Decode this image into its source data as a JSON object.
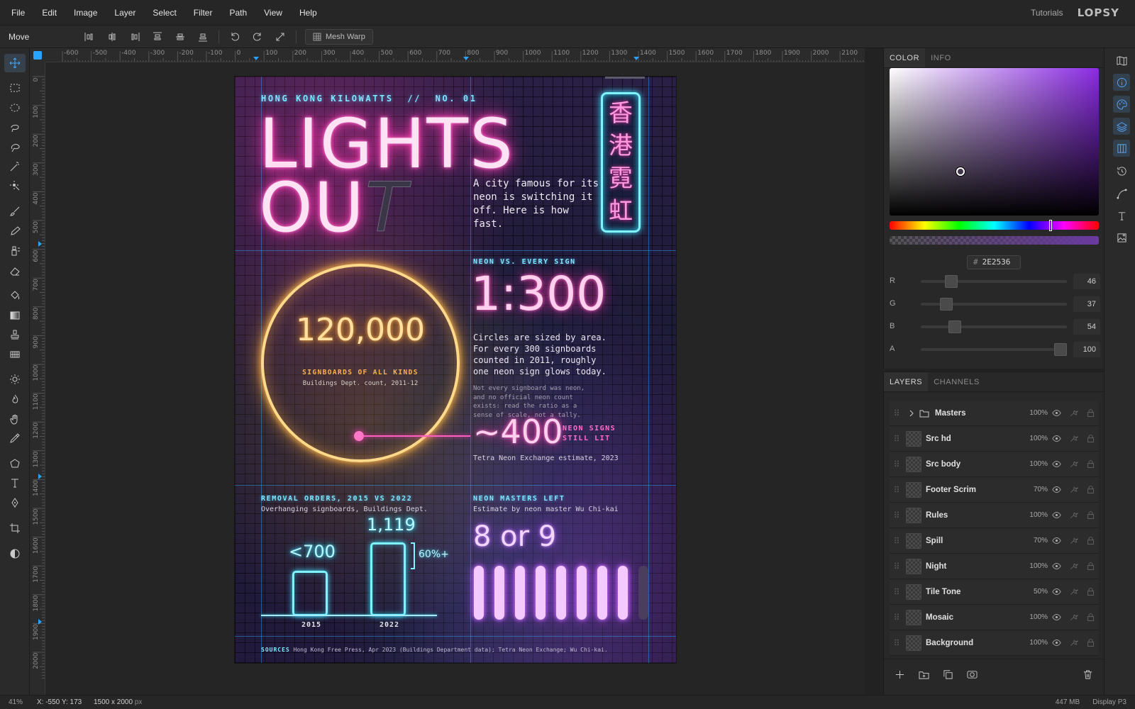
{
  "menu": [
    "File",
    "Edit",
    "Image",
    "Layer",
    "Select",
    "Filter",
    "Path",
    "View",
    "Help"
  ],
  "header": {
    "tutorials": "Tutorials",
    "brand": "LOPSY"
  },
  "options": {
    "tool_name": "Move",
    "mesh_warp": "Mesh Warp"
  },
  "toolbar_icons": [
    "move-icon",
    "rect-select-icon",
    "ellipse-select-icon",
    "lasso-icon",
    "magnetic-lasso-icon",
    "magic-wand-icon",
    "quick-select-icon",
    "brush-icon",
    "pencil-icon",
    "clone-icon",
    "eraser-icon",
    "bucket-icon",
    "gradient-icon",
    "stamp-icon",
    "pattern-icon",
    "dodge-icon",
    "burn-icon",
    "hand-icon",
    "eyedropper-icon",
    "shape-icon",
    "text-icon",
    "pen-icon",
    "crop-icon",
    "contrast-icon"
  ],
  "hruler_labels": [
    "-600",
    "-500",
    "-400",
    "-300",
    "-200",
    "-100",
    "0",
    "100",
    "200",
    "300",
    "400",
    "500",
    "600",
    "700",
    "800",
    "900",
    "1000",
    "1100",
    "1200",
    "1300",
    "1400",
    "1500",
    "1600",
    "1700",
    "1800",
    "1900",
    "2000",
    "2100"
  ],
  "vruler_labels": [
    "0",
    "100",
    "200",
    "300",
    "400",
    "500",
    "600",
    "700",
    "800",
    "900",
    "1000",
    "1100",
    "1200",
    "1300",
    "1400",
    "1500",
    "1600",
    "1700",
    "1800",
    "1900",
    "2000"
  ],
  "poster": {
    "kicker": "HONG KONG KILOWATTS  //  NO. 01",
    "title_line1": "LIGHTS",
    "title_line2": "OU",
    "title_t": "T",
    "intro": "A city famous for its neon is switching it off. Here is how fast.",
    "sign_chars": [
      "香",
      "港",
      "霓",
      "虹"
    ],
    "big_number": "120,000",
    "big_label": "SIGNBOARDS OF ALL KINDS",
    "big_source": "Buildings Dept. count, 2011-12",
    "ratio_label": "NEON VS. EVERY SIGN",
    "ratio": "1:300",
    "ratio_text": "Circles are sized by area. For every 300 signboards counted in 2011, roughly one neon sign glows today.",
    "ratio_note": "Not every signboard was neon, and no official neon count exists: read the ratio as a sense of scale, not a tally.",
    "approx": "~400",
    "approx_label_1": "NEON SIGNS",
    "approx_label_2": "STILL LIT",
    "approx_source": "Tetra Neon Exchange estimate, 2023",
    "removal_title": "REMOVAL ORDERS, 2015 VS 2022",
    "removal_sub": "Overhanging signboards, Buildings Dept.",
    "bar_2015_value": "<700",
    "bar_2022_value": "1,119",
    "bar_2015_label": "2015",
    "bar_2022_label": "2022",
    "pct": "60%+",
    "masters_title": "NEON MASTERS LEFT",
    "masters_sub": "Estimate by neon master Wu Chi-kai",
    "masters_value": "8 or 9",
    "sources_label": "SOURCES",
    "sources_text": "Hong Kong Free Press, Apr 2023 (Buildings Department data); Tetra Neon Exchange; Wu Chi-kai."
  },
  "color_panel": {
    "tabs": [
      "COLOR",
      "INFO"
    ],
    "hex_label": "#",
    "hex": "2E2536",
    "channels": [
      {
        "label": "R",
        "value": "46",
        "level": 0.18
      },
      {
        "label": "G",
        "value": "37",
        "level": 0.145
      },
      {
        "label": "B",
        "value": "54",
        "level": 0.21
      },
      {
        "label": "A",
        "value": "100",
        "level": 1.0
      }
    ]
  },
  "layers_panel": {
    "tabs": [
      "LAYERS",
      "CHANNELS"
    ],
    "layers": [
      {
        "name": "Masters",
        "opacity": "100%",
        "group": true
      },
      {
        "name": "Src hd",
        "opacity": "100%"
      },
      {
        "name": "Src body",
        "opacity": "100%"
      },
      {
        "name": "Footer Scrim",
        "opacity": "70%"
      },
      {
        "name": "Rules",
        "opacity": "100%"
      },
      {
        "name": "Spill",
        "opacity": "70%"
      },
      {
        "name": "Night",
        "opacity": "100%"
      },
      {
        "name": "Tile Tone",
        "opacity": "50%"
      },
      {
        "name": "Mosaic",
        "opacity": "100%"
      },
      {
        "name": "Background",
        "opacity": "100%"
      }
    ]
  },
  "status": {
    "zoom": "41%",
    "coords": "X: -550 Y: 173",
    "doc_size": "1500 x 2000",
    "doc_unit": "px",
    "memory": "447 MB",
    "profile": "Display P3"
  }
}
